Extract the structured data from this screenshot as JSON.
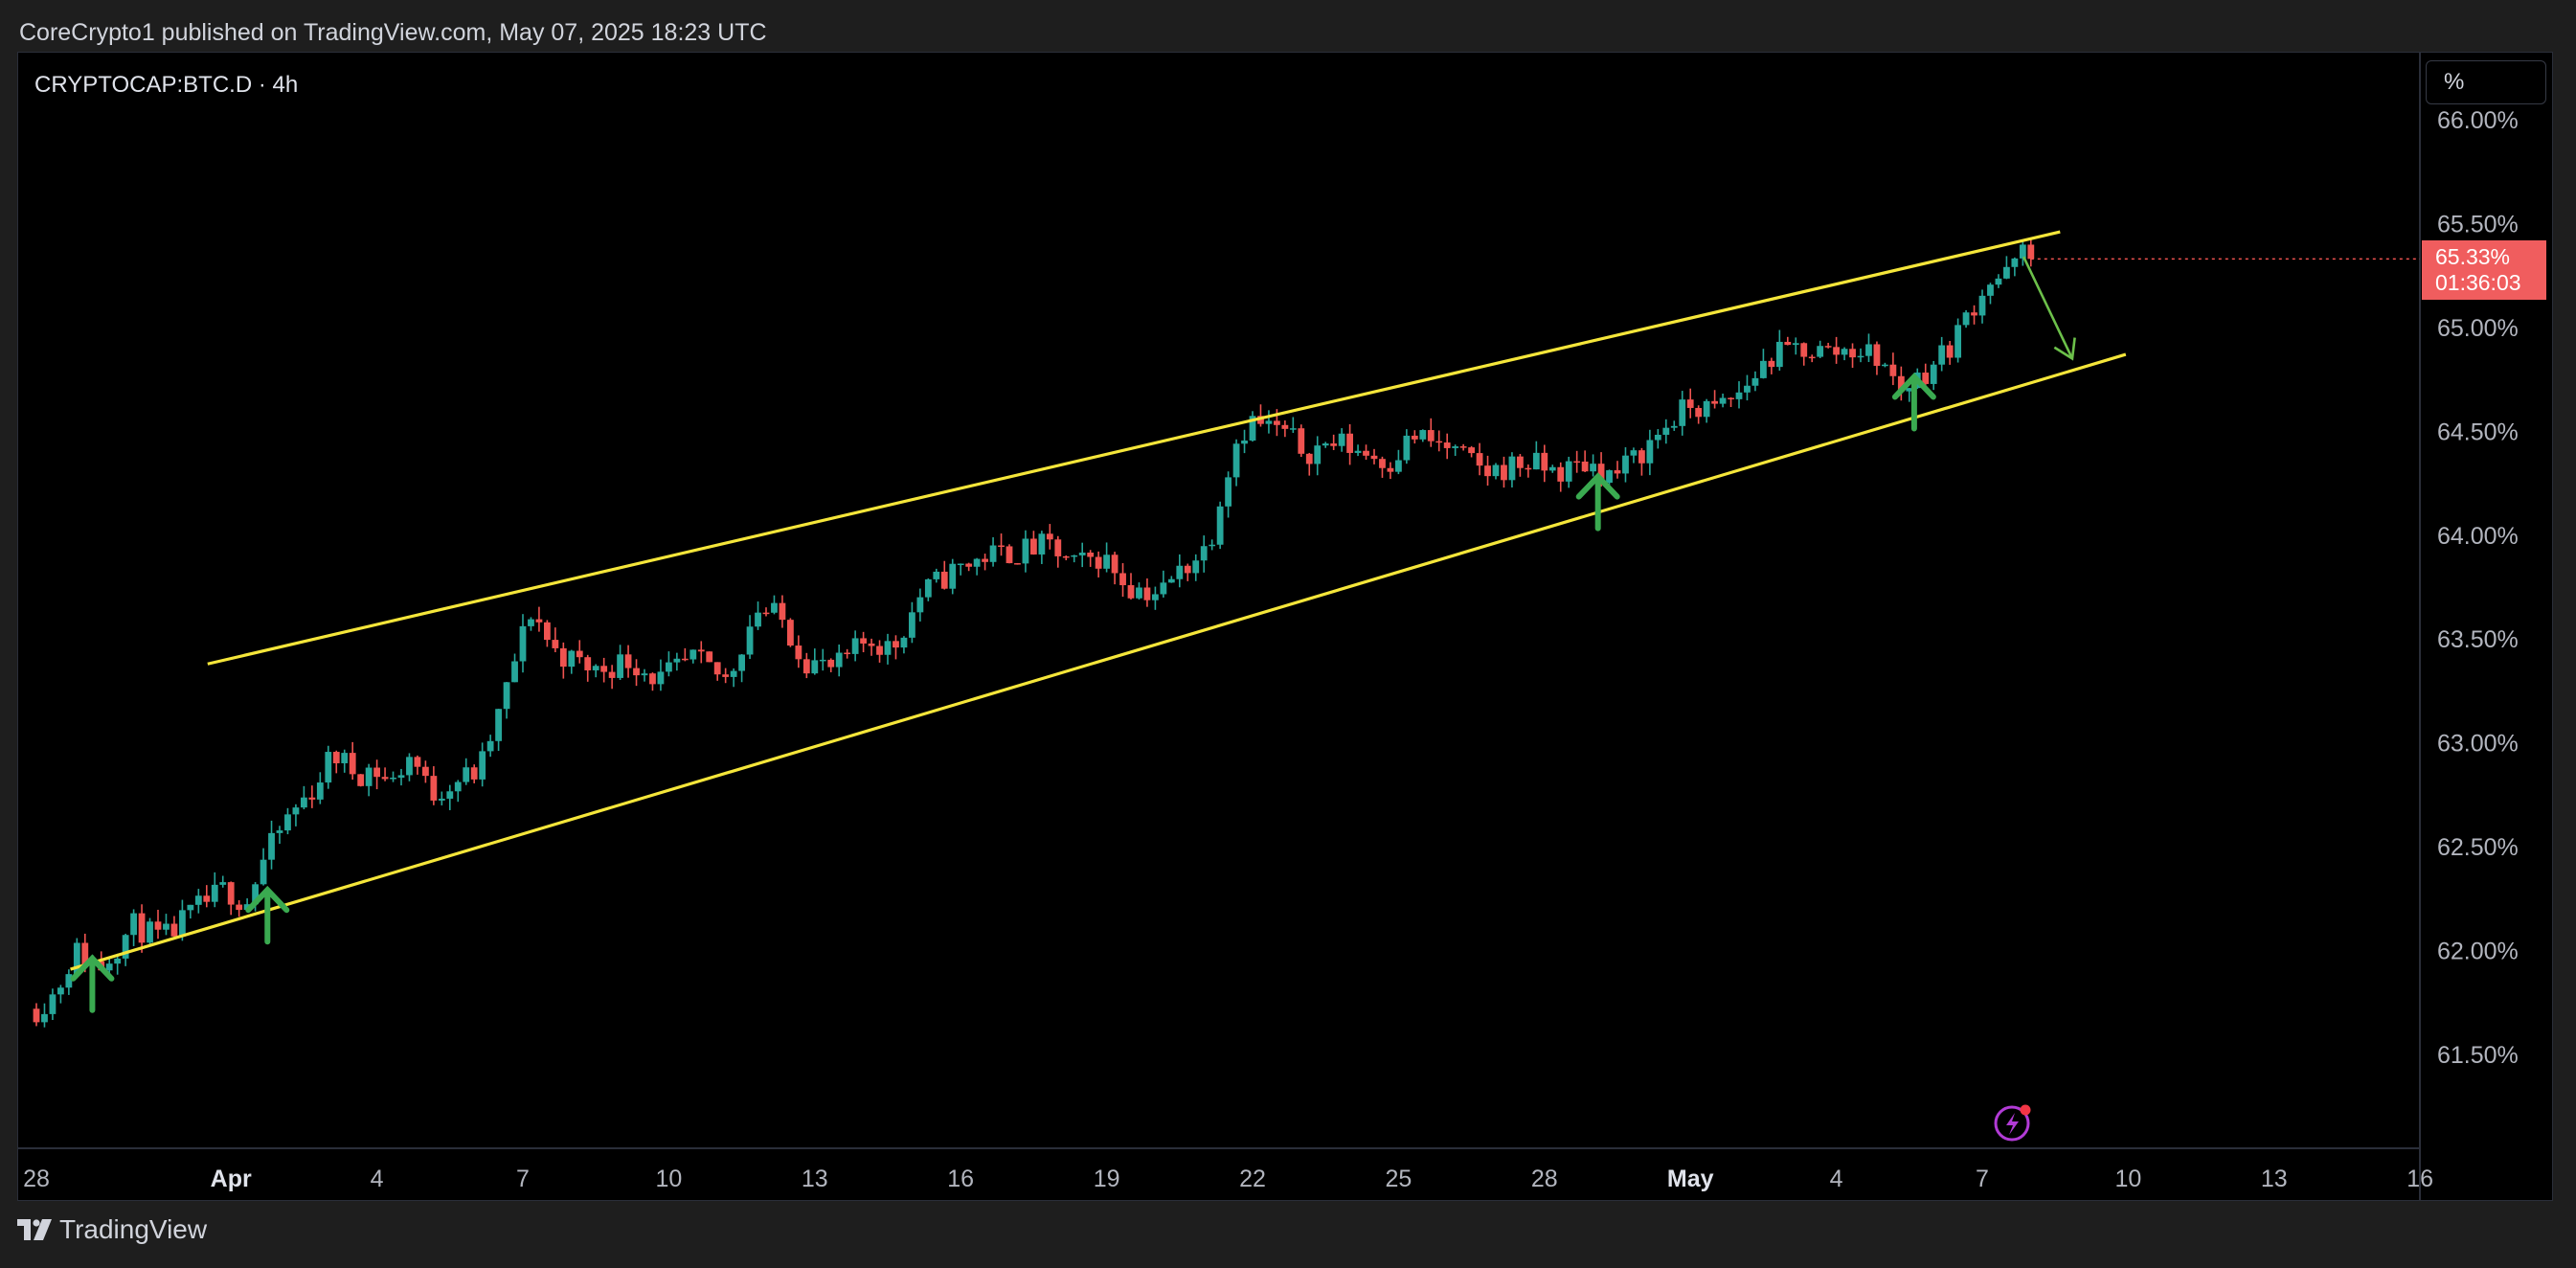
{
  "header": {
    "publisher": "CoreCrypto1 published on TradingView.com, May 07, 2025 18:23 UTC"
  },
  "symbol": "CRYPTOCAP:BTC.D · 4h",
  "scale_mode": "%",
  "last_price": {
    "value": "65.33%",
    "countdown": "01:36:03"
  },
  "brand": "TradingView",
  "chart_data": {
    "type": "candlestick",
    "title": "",
    "ylim": [
      61.1,
      66.1
    ],
    "y_ticks": [
      66.0,
      65.5,
      65.0,
      64.5,
      64.0,
      63.5,
      63.0,
      62.5,
      62.0,
      61.5
    ],
    "y_tick_labels": [
      "66.00%",
      "65.50%",
      "65.00%",
      "64.50%",
      "64.00%",
      "63.50%",
      "63.00%",
      "62.50%",
      "62.00%",
      "61.50%"
    ],
    "x_ticks": [
      {
        "label": "28",
        "day": 0,
        "bold": false
      },
      {
        "label": "Apr",
        "day": 4,
        "bold": true
      },
      {
        "label": "4",
        "day": 7,
        "bold": false
      },
      {
        "label": "7",
        "day": 10,
        "bold": false
      },
      {
        "label": "10",
        "day": 13,
        "bold": false
      },
      {
        "label": "13",
        "day": 16,
        "bold": false
      },
      {
        "label": "16",
        "day": 19,
        "bold": false
      },
      {
        "label": "19",
        "day": 22,
        "bold": false
      },
      {
        "label": "22",
        "day": 25,
        "bold": false
      },
      {
        "label": "25",
        "day": 28,
        "bold": false
      },
      {
        "label": "28",
        "day": 31,
        "bold": false
      },
      {
        "label": "May",
        "day": 34,
        "bold": true
      },
      {
        "label": "4",
        "day": 37,
        "bold": false
      },
      {
        "label": "7",
        "day": 40,
        "bold": false
      },
      {
        "label": "10",
        "day": 43,
        "bold": false
      },
      {
        "label": "13",
        "day": 46,
        "bold": false
      },
      {
        "label": "16",
        "day": 49,
        "bold": false
      }
    ],
    "price_path": [
      [
        0.0,
        61.72
      ],
      [
        0.4,
        61.8
      ],
      [
        0.8,
        62.0
      ],
      [
        1.3,
        61.92
      ],
      [
        2.0,
        62.12
      ],
      [
        2.6,
        62.05
      ],
      [
        3.3,
        62.2
      ],
      [
        3.9,
        62.3
      ],
      [
        4.3,
        62.22
      ],
      [
        4.7,
        62.45
      ],
      [
        5.2,
        62.65
      ],
      [
        5.7,
        62.78
      ],
      [
        6.1,
        62.95
      ],
      [
        6.6,
        62.85
      ],
      [
        6.9,
        62.88
      ],
      [
        7.3,
        62.8
      ],
      [
        7.7,
        62.95
      ],
      [
        8.1,
        62.75
      ],
      [
        8.6,
        62.82
      ],
      [
        9.1,
        62.86
      ],
      [
        9.6,
        63.2
      ],
      [
        9.9,
        63.45
      ],
      [
        10.2,
        63.65
      ],
      [
        10.6,
        63.45
      ],
      [
        11.0,
        63.4
      ],
      [
        11.5,
        63.35
      ],
      [
        12.2,
        63.4
      ],
      [
        12.8,
        63.3
      ],
      [
        13.5,
        63.4
      ],
      [
        14.2,
        63.3
      ],
      [
        14.8,
        63.65
      ],
      [
        15.3,
        63.6
      ],
      [
        15.8,
        63.4
      ],
      [
        16.4,
        63.35
      ],
      [
        17.1,
        63.5
      ],
      [
        17.6,
        63.45
      ],
      [
        18.2,
        63.72
      ],
      [
        18.8,
        63.82
      ],
      [
        19.5,
        63.9
      ],
      [
        20.2,
        63.92
      ],
      [
        20.8,
        63.95
      ],
      [
        21.3,
        63.85
      ],
      [
        21.9,
        63.9
      ],
      [
        22.5,
        63.75
      ],
      [
        23.1,
        63.72
      ],
      [
        23.6,
        63.85
      ],
      [
        24.1,
        63.95
      ],
      [
        24.4,
        64.25
      ],
      [
        24.7,
        64.48
      ],
      [
        25.0,
        64.55
      ],
      [
        25.6,
        64.5
      ],
      [
        26.1,
        64.4
      ],
      [
        26.7,
        64.45
      ],
      [
        27.3,
        64.4
      ],
      [
        27.8,
        64.35
      ],
      [
        28.3,
        64.48
      ],
      [
        29.0,
        64.42
      ],
      [
        29.8,
        64.3
      ],
      [
        30.6,
        64.35
      ],
      [
        31.3,
        64.3
      ],
      [
        31.9,
        64.35
      ],
      [
        32.4,
        64.28
      ],
      [
        33.0,
        64.4
      ],
      [
        33.6,
        64.55
      ],
      [
        34.0,
        64.62
      ],
      [
        34.5,
        64.6
      ],
      [
        35.0,
        64.68
      ],
      [
        35.6,
        64.85
      ],
      [
        36.2,
        64.9
      ],
      [
        36.9,
        64.88
      ],
      [
        37.4,
        64.9
      ],
      [
        37.9,
        64.85
      ],
      [
        38.3,
        64.7
      ],
      [
        38.8,
        64.78
      ],
      [
        39.3,
        64.9
      ],
      [
        39.8,
        65.1
      ],
      [
        40.1,
        65.22
      ],
      [
        40.5,
        65.25
      ],
      [
        40.8,
        65.36
      ],
      [
        41.0,
        65.33
      ]
    ],
    "trend_lines": [
      {
        "x1": 3.52,
        "y1": 63.38,
        "x2": 41.6,
        "y2": 65.46,
        "color": "#f5e63a"
      },
      {
        "x1": 0.7,
        "y1": 61.91,
        "x2": 42.95,
        "y2": 64.87,
        "color": "#f5e63a"
      }
    ],
    "arrow_markers": [
      {
        "day": 1.15,
        "price": 61.75
      },
      {
        "day": 4.75,
        "price": 62.08
      },
      {
        "day": 32.1,
        "price": 64.07
      },
      {
        "day": 38.6,
        "price": 64.55
      }
    ],
    "projection_arrow": {
      "x1": 40.85,
      "y1": 65.34,
      "x2": 41.85,
      "y2": 64.85
    },
    "colors": {
      "up": "#26a69a",
      "down": "#ef5350",
      "trend": "#f5e63a",
      "marker": "#3aaa50"
    }
  }
}
